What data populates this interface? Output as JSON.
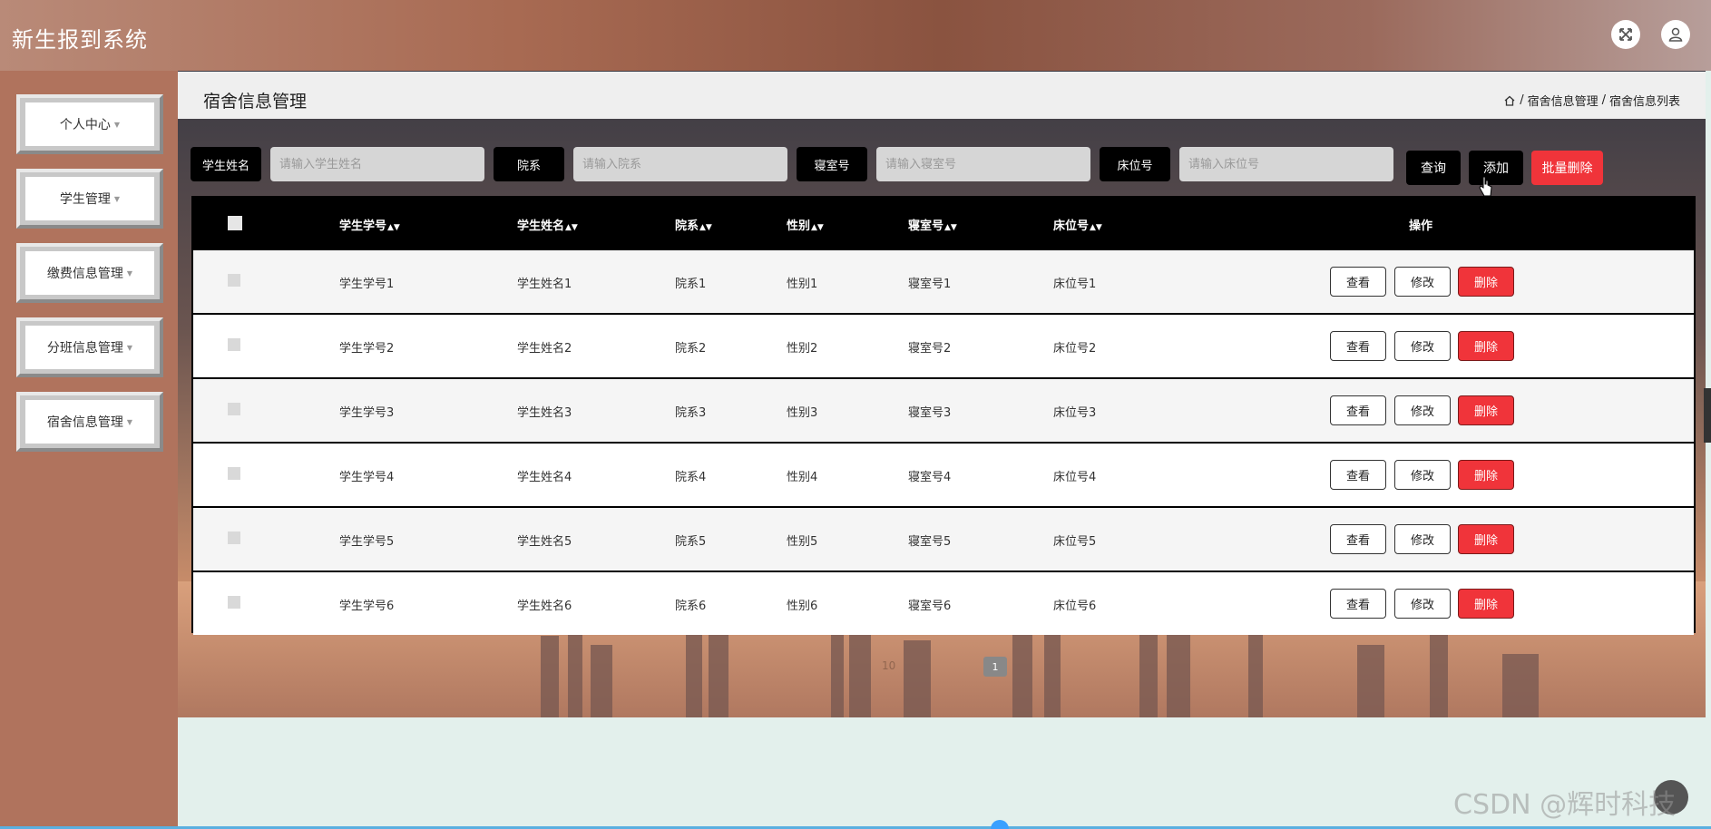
{
  "app": {
    "title": "新生报到系统"
  },
  "header": {
    "fullscreen_icon": "expand-icon",
    "user_icon": "user-icon"
  },
  "sidebar": {
    "items": [
      {
        "label": "个人中心"
      },
      {
        "label": "学生管理"
      },
      {
        "label": "缴费信息管理"
      },
      {
        "label": "分班信息管理"
      },
      {
        "label": "宿舍信息管理"
      }
    ]
  },
  "page": {
    "title": "宿舍信息管理",
    "breadcrumb": [
      "宿舍信息管理",
      "宿舍信息列表"
    ],
    "breadcrumb_sep": "/"
  },
  "search": {
    "student_name_label": "学生姓名",
    "student_name_placeholder": "请输入学生姓名",
    "dept_label": "院系",
    "dept_placeholder": "请输入院系",
    "room_label": "寝室号",
    "room_placeholder": "请输入寝室号",
    "bed_label": "床位号",
    "bed_placeholder": "请输入床位号",
    "query": "查询",
    "add": "添加",
    "batch_delete": "批量删除"
  },
  "table": {
    "headers": [
      "学生学号",
      "学生姓名",
      "院系",
      "性别",
      "寝室号",
      "床位号",
      "操作"
    ],
    "rows": [
      [
        "学生学号1",
        "学生姓名1",
        "院系1",
        "性别1",
        "寝室号1",
        "床位号1"
      ],
      [
        "学生学号2",
        "学生姓名2",
        "院系2",
        "性别2",
        "寝室号2",
        "床位号2"
      ],
      [
        "学生学号3",
        "学生姓名3",
        "院系3",
        "性别3",
        "寝室号3",
        "床位号3"
      ],
      [
        "学生学号4",
        "学生姓名4",
        "院系4",
        "性别4",
        "寝室号4",
        "床位号4"
      ],
      [
        "学生学号5",
        "学生姓名5",
        "院系5",
        "性别5",
        "寝室号5",
        "床位号5"
      ],
      [
        "学生学号6",
        "学生姓名6",
        "院系6",
        "性别6",
        "寝室号6",
        "床位号6"
      ]
    ],
    "actions": {
      "view": "查看",
      "edit": "修改",
      "delete": "删除"
    }
  },
  "pagination": {
    "current": "1",
    "page_size": "10"
  },
  "watermark": "CSDN @辉时科技",
  "colors": {
    "accent_red": "#f0343a",
    "header_black": "#000000"
  }
}
